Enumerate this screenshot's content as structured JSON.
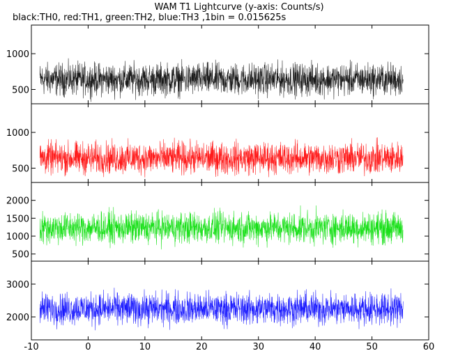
{
  "title": "WAM T1 Lightcurve (y-axis: Counts/s)",
  "subtitle": "black:TH0, red:TH1, green:TH2, blue:TH3 ,1bin = 0.015625s",
  "chart_data": {
    "type": "line",
    "title": "WAM T1 Lightcurve (y-axis: Counts/s)",
    "subtitle": "black:TH0, red:TH1, green:TH2, blue:TH3 ,1bin = 0.015625s",
    "xlabel": "",
    "ylabel": "Counts/s",
    "bin_width_s": 0.015625,
    "xlim": [
      -10,
      60
    ],
    "x_ticks": [
      -10,
      0,
      10,
      20,
      30,
      40,
      50,
      60
    ],
    "x_data_range": [
      -8.5,
      55.5
    ],
    "grid": false,
    "series": [
      {
        "name": "TH0",
        "color": "#000000",
        "ylim": [
          300,
          1400
        ],
        "y_ticks": [
          500,
          1000
        ],
        "mean": 640,
        "spread": 330
      },
      {
        "name": "TH1",
        "color": "#ff0000",
        "ylim": [
          300,
          1400
        ],
        "y_ticks": [
          500,
          1000
        ],
        "mean": 640,
        "spread": 330
      },
      {
        "name": "TH2",
        "color": "#00dd00",
        "ylim": [
          300,
          2500
        ],
        "y_ticks": [
          500,
          1000,
          1500,
          2000
        ],
        "mean": 1230,
        "spread": 650
      },
      {
        "name": "TH3",
        "color": "#0000ff",
        "ylim": [
          1300,
          3700
        ],
        "y_ticks": [
          2000,
          3000
        ],
        "mean": 2250,
        "spread": 720
      }
    ]
  }
}
